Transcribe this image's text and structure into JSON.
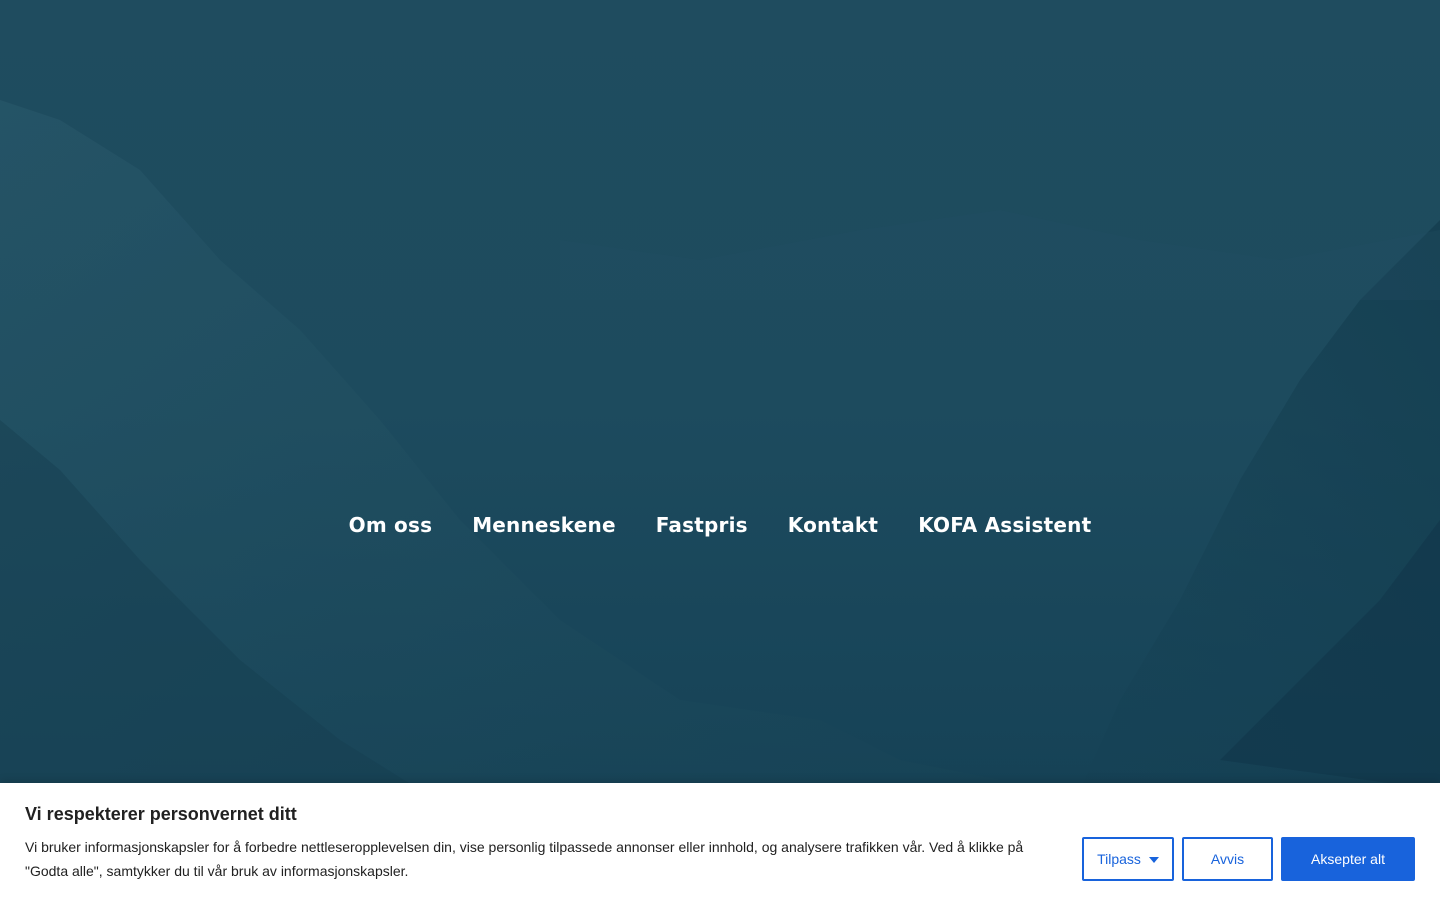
{
  "nav": {
    "items": [
      {
        "label": "Om oss"
      },
      {
        "label": "Menneskene"
      },
      {
        "label": "Fastpris"
      },
      {
        "label": "Kontakt"
      },
      {
        "label": "KOFA Assistent"
      }
    ]
  },
  "cookie": {
    "title": "Vi respekterer personvernet ditt",
    "text": "Vi bruker informasjonskapsler for å forbedre nettleseropplevelsen din, vise personlig tilpassede annonser eller innhold, og analysere trafikken vår. Ved å klikke på \"Godta alle\", samtykker du til vår bruk av informasjonskapsler.",
    "customize_label": "Tilpass",
    "reject_label": "Avvis",
    "accept_label": "Aksepter alt"
  },
  "colors": {
    "hero_overlay": "#1f4c5f",
    "accent": "#1863dc",
    "nav_text": "#ffffff"
  },
  "icons": {
    "customize_caret": "caret-down-icon"
  }
}
